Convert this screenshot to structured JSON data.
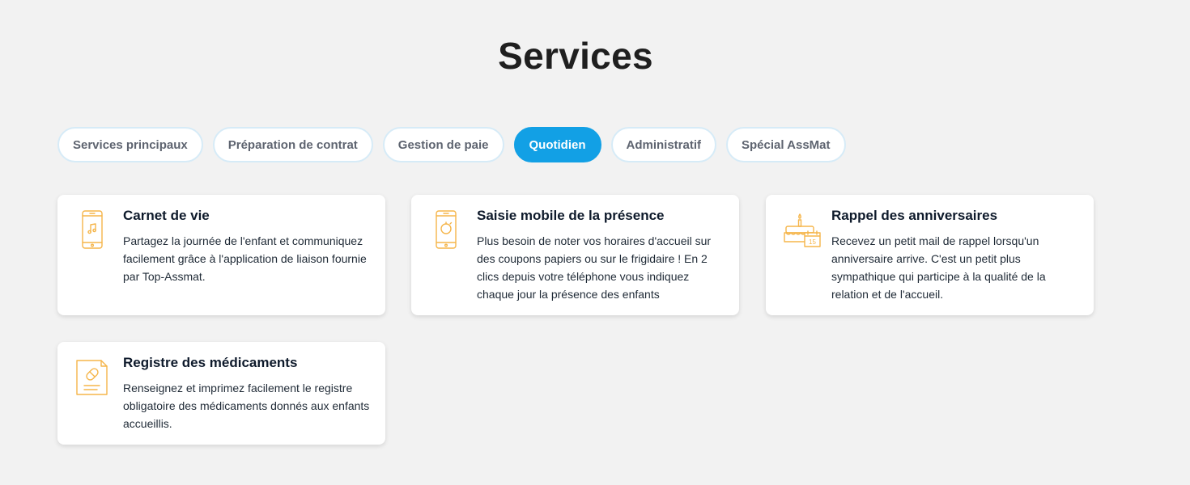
{
  "page": {
    "title": "Services"
  },
  "tabs": [
    {
      "label": "Services principaux",
      "active": false
    },
    {
      "label": "Préparation de contrat",
      "active": false
    },
    {
      "label": "Gestion de paie",
      "active": false
    },
    {
      "label": "Quotidien",
      "active": true
    },
    {
      "label": "Administratif",
      "active": false
    },
    {
      "label": "Spécial AssMat",
      "active": false
    }
  ],
  "cards": [
    {
      "icon": "smartphone-music-icon",
      "title": "Carnet de vie",
      "text": "Partagez la journée de l'enfant et communiquez facilement grâce à l'application de liaison fournie par Top-Assmat."
    },
    {
      "icon": "smartphone-clock-icon",
      "title": "Saisie mobile de la présence",
      "text": "Plus besoin de noter vos horaires d'accueil sur des coupons papiers ou sur le frigidaire ! En 2 clics depuis votre téléphone vous indiquez chaque jour la présence des enfants"
    },
    {
      "icon": "birthday-cake-calendar-icon",
      "title": "Rappel des anniversaires",
      "text": "Recevez un petit mail de rappel lorsqu'un anniversaire arrive. C'est un petit plus sympathique qui participe à la qualité de la relation et de l'accueil.",
      "calendar_day": "15"
    },
    {
      "icon": "medication-register-icon",
      "title": "Registre des médicaments",
      "text": "Renseignez et imprimez facilement le registre obligatoire des médicaments donnés aux enfants accueillis."
    }
  ],
  "colors": {
    "background": "#f2f2f2",
    "accent": "#12a0e5",
    "tab_border": "#d6ebf7",
    "icon": "#f5b54a"
  }
}
